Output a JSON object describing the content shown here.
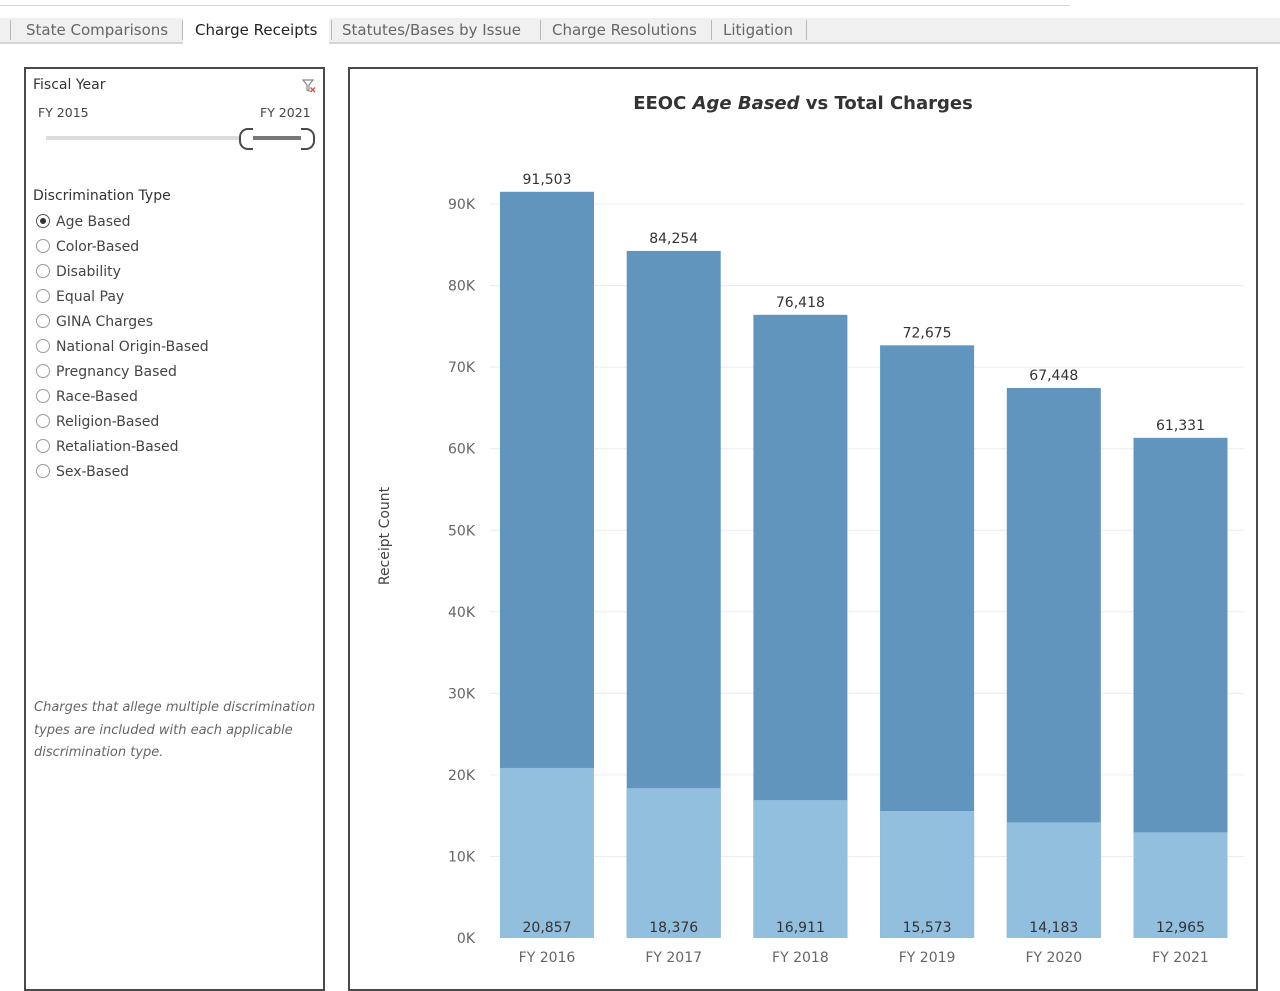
{
  "tabs": [
    {
      "label": "State Comparisons",
      "active": false
    },
    {
      "label": "Charge Receipts",
      "active": true
    },
    {
      "label": "Statutes/Bases by Issue",
      "active": false
    },
    {
      "label": "Charge Resolutions",
      "active": false
    },
    {
      "label": "Litigation",
      "active": false
    }
  ],
  "filters": {
    "fiscal_year": {
      "title": "Fiscal Year",
      "min_label": "FY 2015",
      "max_label": "FY 2021",
      "clear_icon": "clear-filter-icon"
    },
    "discrimination_type": {
      "title": "Discrimination Type",
      "selected": "Age Based",
      "options": [
        "Age Based",
        "Color-Based",
        "Disability",
        "Equal Pay",
        "GINA Charges",
        "National Origin-Based",
        "Pregnancy Based",
        "Race-Based",
        "Religion-Based",
        "Retaliation-Based",
        "Sex-Based"
      ]
    },
    "note": "Charges that allege multiple discrimination types are included with each applicable discrimination type."
  },
  "chart": {
    "title_prefix": "EEOC ",
    "title_emphasis": "Age Based",
    "title_suffix": " vs Total Charges",
    "colors": {
      "total": "#6295be",
      "selected": "#93bfdf"
    }
  },
  "chart_data": {
    "type": "bar",
    "stacked": false,
    "overlapping": true,
    "categories": [
      "FY 2016",
      "FY 2017",
      "FY 2018",
      "FY 2019",
      "FY 2020",
      "FY 2021"
    ],
    "series": [
      {
        "values": [
          91503,
          84254,
          76418,
          72675,
          67448,
          61331
        ]
      },
      {
        "values": [
          20857,
          18376,
          16911,
          15573,
          14183,
          12965
        ]
      }
    ],
    "ylabel": "Receipt Count",
    "ylim": [
      0,
      95000
    ],
    "yticks": [
      0,
      10000,
      20000,
      30000,
      40000,
      50000,
      60000,
      70000,
      80000,
      90000
    ],
    "ytick_labels": [
      "0K",
      "10K",
      "20K",
      "30K",
      "40K",
      "50K",
      "60K",
      "70K",
      "80K",
      "90K"
    ],
    "grid": true
  }
}
